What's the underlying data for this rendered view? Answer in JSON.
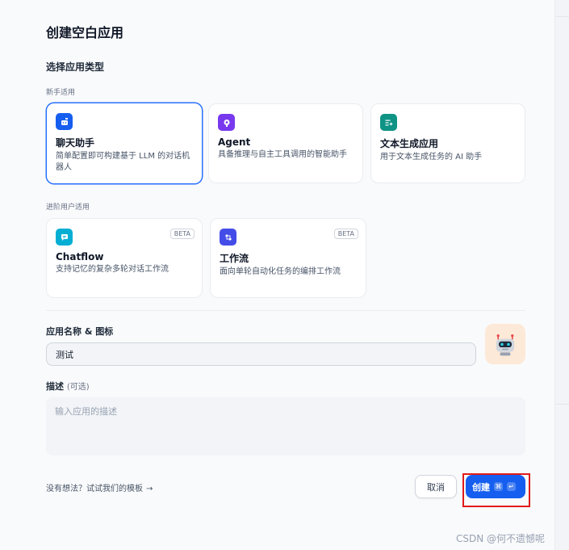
{
  "dialog": {
    "title": "创建空白应用",
    "section_label": "选择应用类型",
    "beginner_label": "新手适用",
    "advanced_label": "进阶用户适用"
  },
  "app_types": {
    "beginner": [
      {
        "name": "聊天助手",
        "desc": "简单配置即可构建基于 LLM 的对话机器人",
        "icon": "chat-bot-icon",
        "color": "#155eef",
        "selected": true
      },
      {
        "name": "Agent",
        "desc": "具备推理与自主工具调用的智能助手",
        "icon": "agent-icon",
        "color": "#7839ee",
        "selected": false
      },
      {
        "name": "文本生成应用",
        "desc": "用于文本生成任务的 AI 助手",
        "icon": "text-generation-icon",
        "color": "#0e9384",
        "selected": false
      }
    ],
    "advanced": [
      {
        "name": "Chatflow",
        "desc": "支持记忆的复杂多轮对话工作流",
        "icon": "chatflow-icon",
        "color": "#06aed4",
        "badge": "BETA"
      },
      {
        "name": "工作流",
        "desc": "面向单轮自动化任务的编排工作流",
        "icon": "workflow-icon",
        "color": "#444ce7",
        "badge": "BETA"
      }
    ]
  },
  "form": {
    "name_label": "应用名称 & 图标",
    "name_value": "测试",
    "avatar_icon": "robot-emoji-icon",
    "desc_label": "描述",
    "desc_optional": "(可选)",
    "desc_placeholder": "输入应用的描述"
  },
  "footer": {
    "template_link": "没有想法？试试我们的模板",
    "template_arrow": "→",
    "cancel_label": "取消",
    "create_label": "创建",
    "create_shortcut_cmd": "⌘",
    "create_shortcut_enter": "↵"
  },
  "watermark": "CSDN @何不遗憾呢",
  "colors": {
    "primary": "#155eef",
    "highlight": "#e01b1b"
  }
}
